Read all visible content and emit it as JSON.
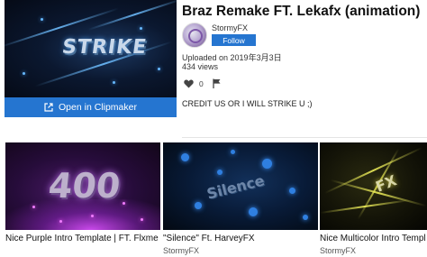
{
  "asset": {
    "title": "Braz Remake FT. Lekafx (animation)",
    "thumbnail_text": "STRIKE",
    "open_button_label": "Open in Clipmaker",
    "creator": {
      "name": "StormyFX",
      "follow_label": "Follow"
    },
    "uploaded": "Uploaded on 2019年3月3日",
    "views": "434 views",
    "likes": "0",
    "description": "CREDIT US OR I WILL STRIKE U ;)"
  },
  "related": [
    {
      "title": "Nice Purple Intro Template | FT. Flxme",
      "creator": "",
      "thumbnail_text": "400"
    },
    {
      "title": "\"Silence\" Ft. HarveyFX",
      "creator": "StormyFX",
      "thumbnail_text": "Silence"
    },
    {
      "title": "Nice Multicolor Intro Templ",
      "creator": "StormyFX",
      "thumbnail_text": "FX"
    }
  ],
  "colors": {
    "accent": "#2575d0",
    "text": "#222222",
    "divider": "#e4e4e4"
  },
  "icons": {
    "open": "external-link-icon",
    "like": "heart-icon",
    "flag": "flag-icon"
  }
}
